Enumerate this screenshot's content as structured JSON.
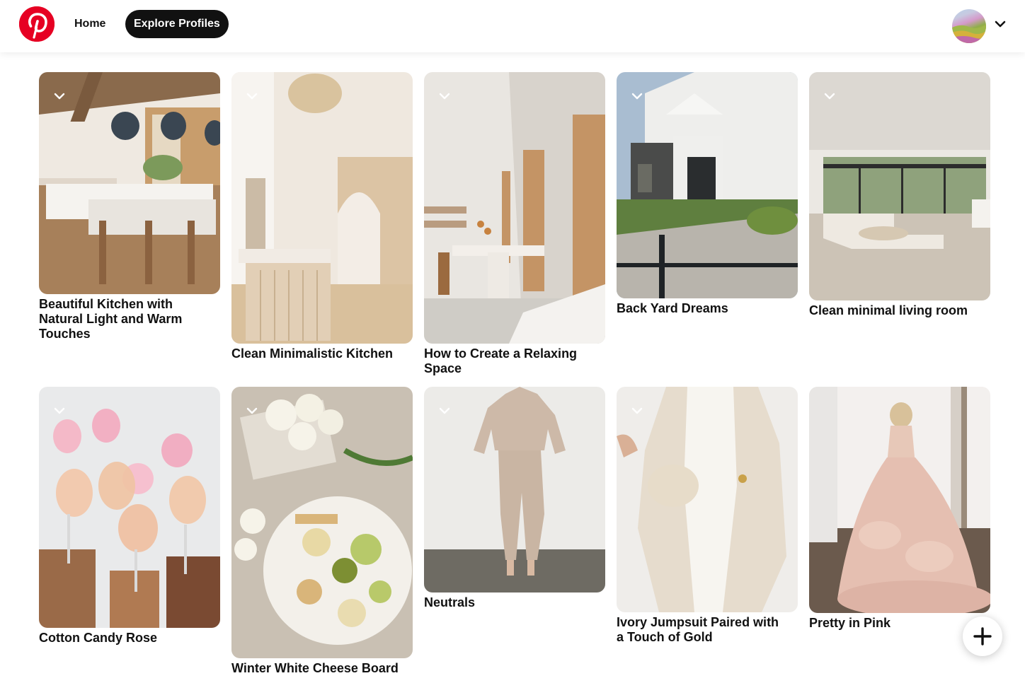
{
  "header": {
    "logo_icon": "pinterest-logo-icon",
    "brand_color": "#e60023",
    "nav": {
      "home_label": "Home",
      "explore_label": "Explore Profiles"
    },
    "account_chevron_icon": "chevron-down-icon"
  },
  "pins": [
    {
      "title": "Beautiful Kitchen with Natural Light and Warm Touches"
    },
    {
      "title": "Clean Minimalistic Kitchen"
    },
    {
      "title": "How to Create a Relaxing Space"
    },
    {
      "title": "Back Yard Dreams"
    },
    {
      "title": "Clean minimal living room"
    },
    {
      "title": "Cotton Candy Rose"
    },
    {
      "title": "Winter White Cheese Board"
    },
    {
      "title": "Neutrals"
    },
    {
      "title": "Ivory Jumpsuit Paired with a Touch of Gold"
    },
    {
      "title": "Pretty in Pink"
    }
  ],
  "pin_menu_icon": "chevron-down-icon",
  "fab_icon": "plus-icon"
}
